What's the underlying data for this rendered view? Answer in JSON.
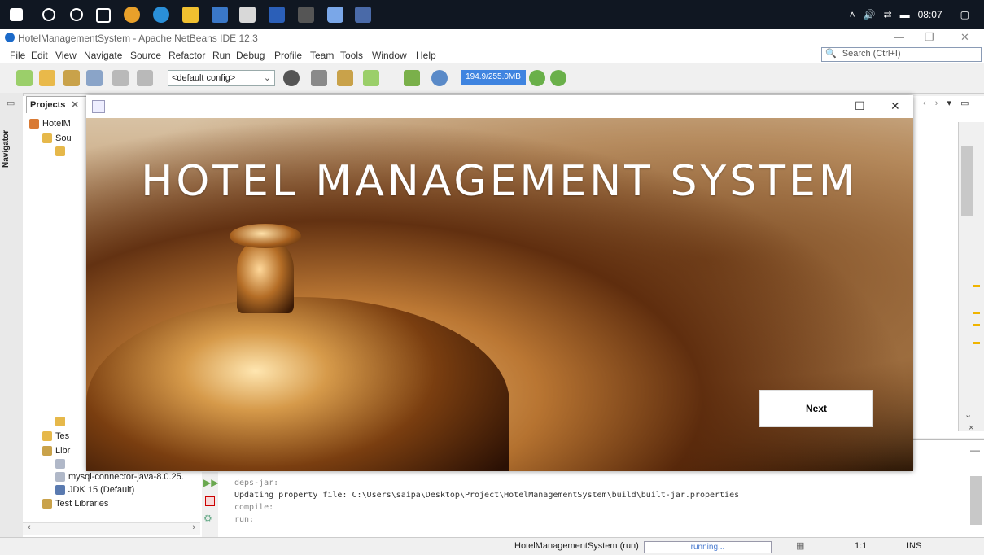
{
  "taskbar": {
    "clock": "08:07"
  },
  "ide": {
    "window_title": "HotelManagementSystem - Apache NetBeans IDE 12.3",
    "menu": [
      "File",
      "Edit",
      "View",
      "Navigate",
      "Source",
      "Refactor",
      "Run",
      "Debug",
      "Profile",
      "Team",
      "Tools",
      "Window",
      "Help"
    ],
    "search_placeholder": "Search (Ctrl+I)",
    "config_select": "<default config>",
    "memory": "194.9/255.0MB",
    "projects_tab": "Projects",
    "navigator_label": "Navigator",
    "tree": {
      "project": "HotelM",
      "sources": "Sou",
      "test_packages": "Tes",
      "libraries": "Libr",
      "mysql_lib": "mysql-connector-java-8.0.25.",
      "jdk": "JDK 15 (Default)",
      "test_libraries": "Test Libraries"
    },
    "output_lines": [
      "deps-jar:",
      "Updating property file: C:\\Users\\saipa\\Desktop\\Project\\HotelManagementSystem\\build\\built-jar.properties",
      "compile:",
      "run:"
    ],
    "status": {
      "task": "HotelManagementSystem (run)",
      "progress_text": "running...",
      "position": "1:1",
      "mode": "INS"
    }
  },
  "app": {
    "heading": "HOTEL MANAGEMENT SYSTEM",
    "next_label": "Next"
  }
}
